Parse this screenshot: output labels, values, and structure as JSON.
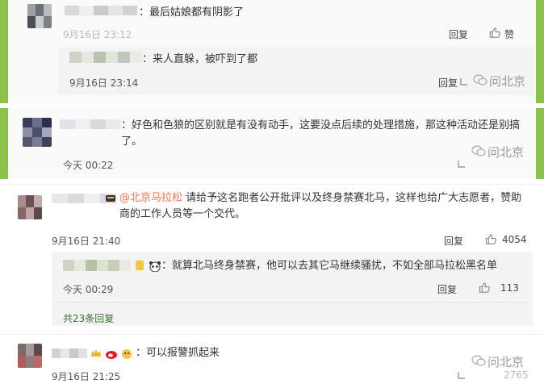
{
  "panel1": {
    "comment": "：最后姑娘都有阴影了",
    "time": "9月16日 23:12",
    "reply": "回复",
    "like": "赞",
    "sub": {
      "text": "：来人直躲，被吓到了都",
      "time": "9月16日 23:14",
      "reply": "回复",
      "watermark": "问北京"
    }
  },
  "panel2": {
    "comment": "：好色和色狼的区别就是有没有动手，这要没点后续的处理措施，那这种活动还是别搞了。",
    "time": "今天 00:22",
    "watermark": "问北京"
  },
  "panel3": {
    "c1": {
      "mention": "@北京马拉松",
      "text": "请给予这名跑者公开批评以及终身禁赛北马，这样也给广大志愿者，赞助商的工作人员等一个交代。",
      "time": "9月16日 21:40",
      "reply": "回复",
      "likes": "4054"
    },
    "sub": {
      "text": "：就算北马终身禁赛，他可以去其它马继续骚扰，不如全部马拉松黑名单",
      "time": "今天 00:29",
      "reply": "回复",
      "likes": "113"
    },
    "more": "共23条回复",
    "c2": {
      "text": "：可以报警抓起来",
      "time": "9月16日 21:25",
      "likes": "2765",
      "watermark": "问北京"
    }
  },
  "colors": {
    "green": "#8bc34a",
    "link": "#3b6e32",
    "mention": "#eb7350"
  }
}
